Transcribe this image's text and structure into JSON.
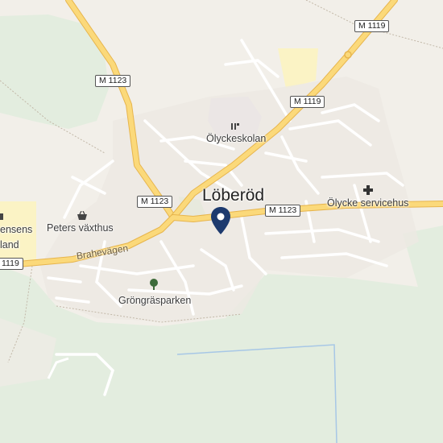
{
  "map": {
    "town_label": "Löberöd",
    "road_shields": {
      "top_right": "M 1119",
      "upper_left": "M 1123",
      "upper_center": "M 1119",
      "mid_left": "M 1123",
      "mid_center": "M 1123",
      "bottom_left": "1119"
    },
    "street_labels": {
      "brahevagen": "Brahevägen"
    },
    "poi_labels": {
      "school": "Ölyckeskolan",
      "service_home": "Ölycke servicehus",
      "nursery": "Peters växthus",
      "park": "Gröngräsparken",
      "partial_top": "ensens",
      "partial_bottom": "land"
    },
    "icons": {
      "school": "school-icon",
      "service_home": "cross-icon",
      "nursery": "shopping-basket-icon",
      "park": "tree-icon",
      "marker": "location-pin-icon"
    },
    "colors": {
      "land": "#f2efe9",
      "forest": "#e3eddf",
      "major_road": "#fbd97a",
      "major_road_edge": "#e7b54d",
      "minor_road": "#ffffff",
      "school_area": "#e5d9ee",
      "service_area": "#fbf3c5",
      "pin": "#1d3a6e"
    }
  }
}
